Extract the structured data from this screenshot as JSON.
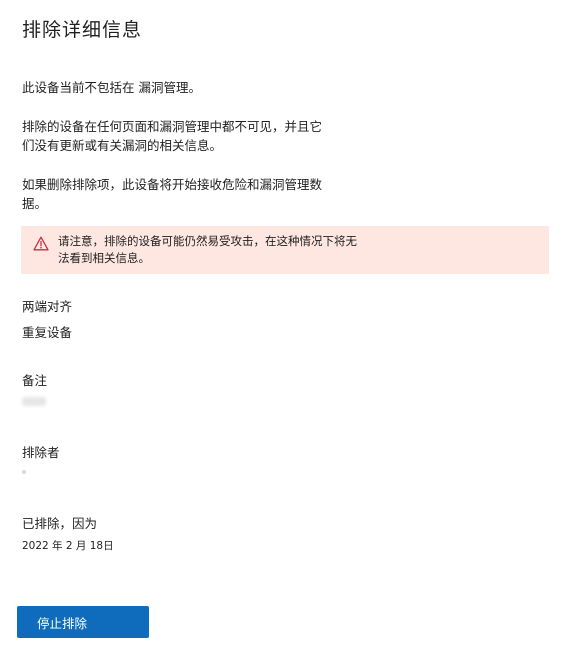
{
  "panel": {
    "title": "排除详细信息"
  },
  "description": {
    "line1": "此设备当前不包括在 漏洞管理。",
    "line2": "排除的设备在任何页面和漏洞管理中都不可见，并且它们没有更新或有关漏洞的相关信息。",
    "line3": "如果删除排除项，此设备将开始接收危险和漏洞管理数据。"
  },
  "warning": {
    "icon": "warning-triangle-icon",
    "text": "请注意，排除的设备可能仍然易受攻击，在这种情况下将无法看到相关信息。",
    "background": "#fde7e0",
    "icon_color": "#c4314b"
  },
  "fields": {
    "justification_label": "两端对齐",
    "justification_value": "重复设备",
    "notes_label": "备注",
    "excluded_by_label": "排除者",
    "excluded_on_label": "已排除，因为",
    "excluded_on_value": "2022 年 2 月 18日"
  },
  "actions": {
    "stop_exclusion_label": "停止排除",
    "button_color": "#0f6cbd"
  }
}
